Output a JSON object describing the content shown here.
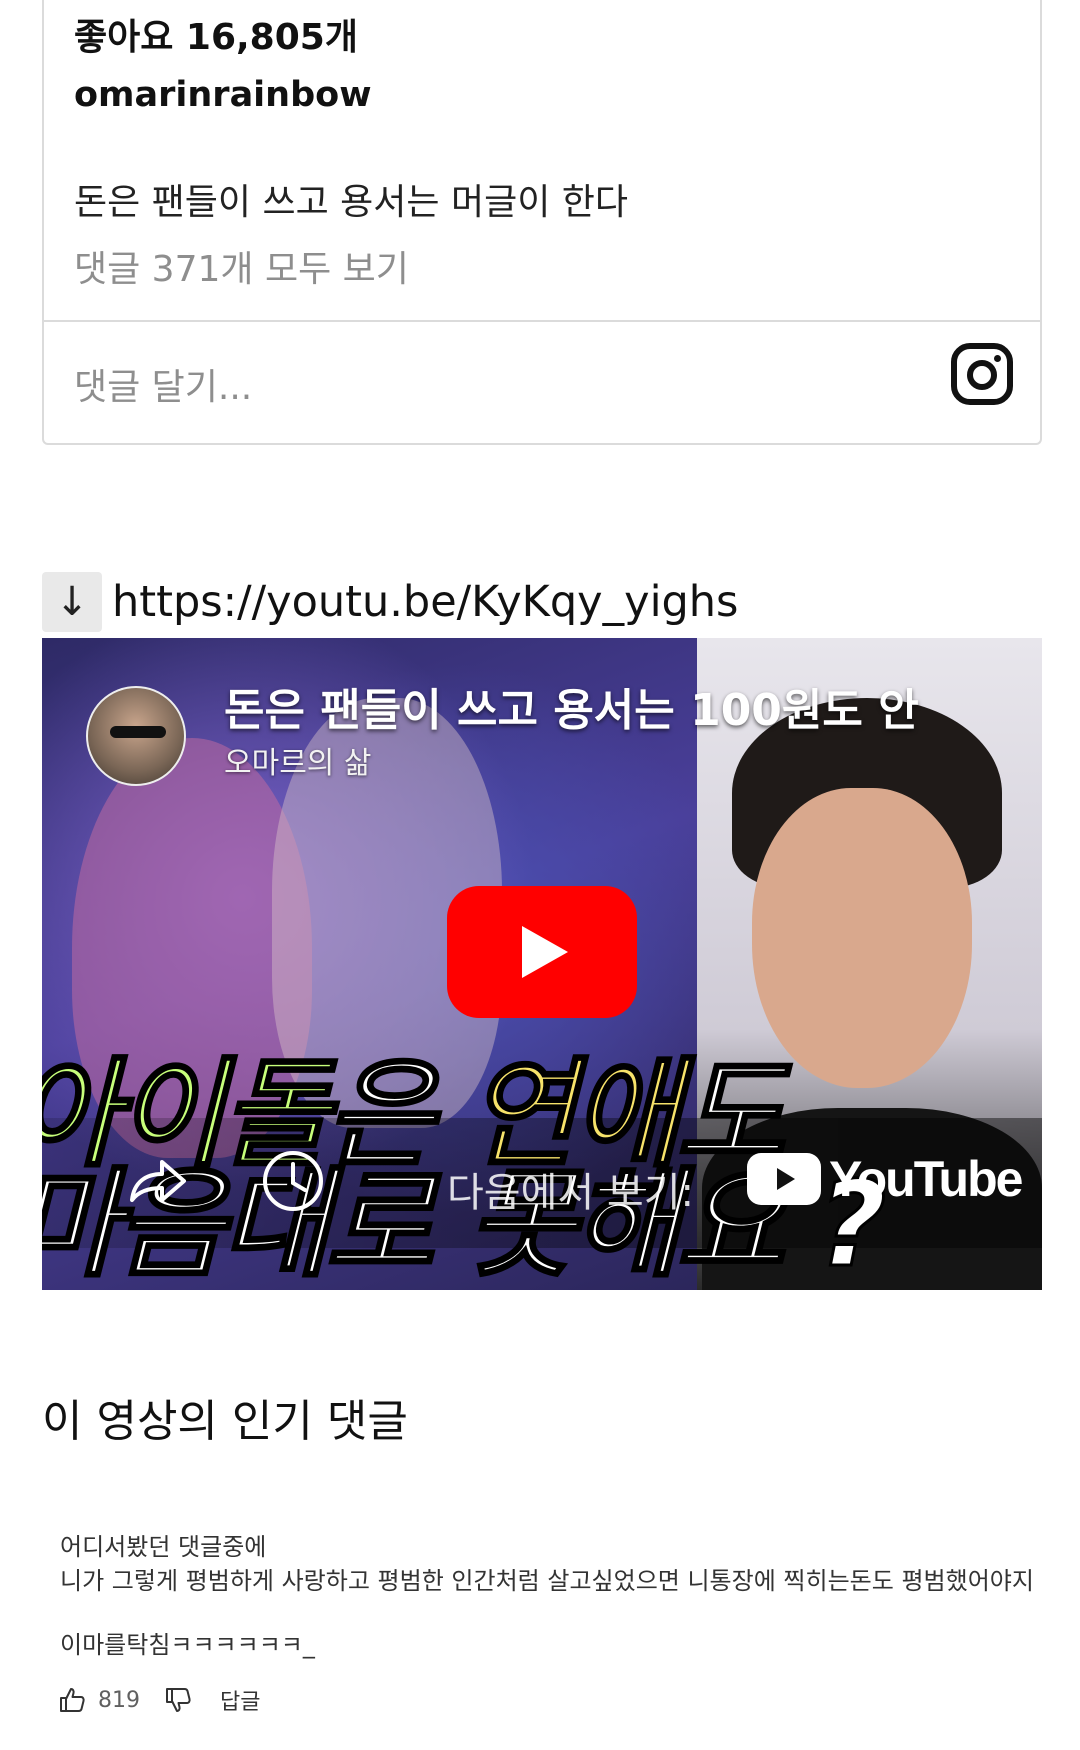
{
  "instagram": {
    "likes": "좋아요 16,805개",
    "username": "omarinrainbow",
    "caption": "돈은 팬들이 쓰고 용서는 머글이 한다",
    "view_comments": "댓글 371개 모두 보기",
    "comment_placeholder": "댓글 달기...",
    "logo_icon": "instagram-icon"
  },
  "link": {
    "arrow": "↓",
    "url": "https://youtu.be/KyKqy_yighs"
  },
  "youtube": {
    "title": "돈은 팬들이 쓰고 용서는 100원도 안",
    "channel": "오마르의 삶",
    "overlay_line1_part1": "아이돌",
    "overlay_line1_part2": "은 ",
    "overlay_line1_part3": "연애",
    "overlay_line1_part4": "도",
    "overlay_line2": "마음대로 못해요 ?",
    "watch_on": "다음에서 보기:",
    "logo_text": "YouTube",
    "play_color": "#ff0000"
  },
  "comments_section": {
    "title": "이 영상의 인기 댓글",
    "comment": {
      "line1": "어디서봤던 댓글중에",
      "line2": "니가 그렇게 평범하게 사랑하고 평범한 인간처럼 살고싶었으면 니통장에 찍히는돈도 평범했어야지",
      "line3": "이마를탁침ㅋㅋㅋㅋㅋㅋ_",
      "likes": "819",
      "reply": "답글"
    }
  }
}
